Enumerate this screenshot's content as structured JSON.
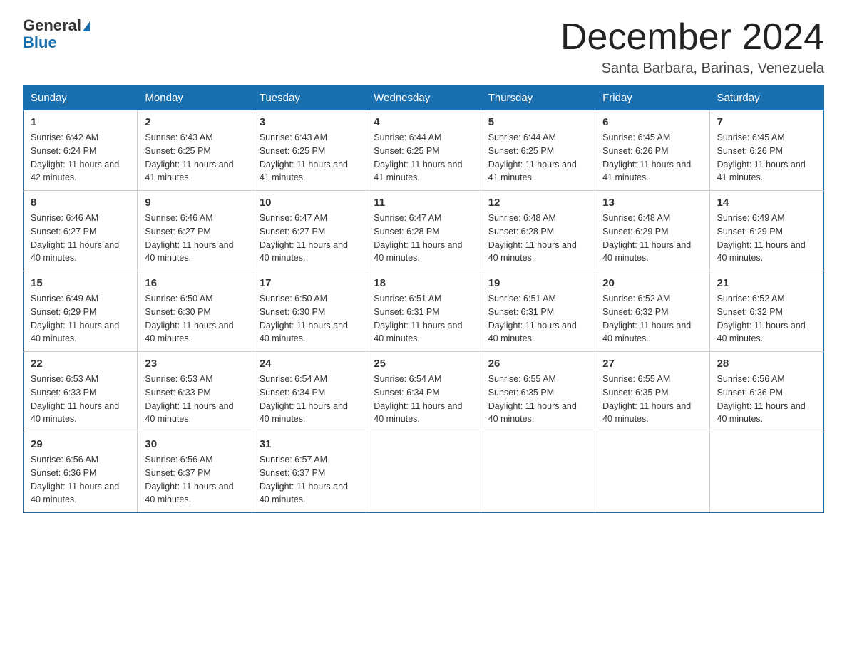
{
  "logo": {
    "text_general": "General",
    "text_blue": "Blue"
  },
  "header": {
    "month_title": "December 2024",
    "subtitle": "Santa Barbara, Barinas, Venezuela"
  },
  "columns": [
    "Sunday",
    "Monday",
    "Tuesday",
    "Wednesday",
    "Thursday",
    "Friday",
    "Saturday"
  ],
  "weeks": [
    [
      {
        "day": "1",
        "sunrise": "Sunrise: 6:42 AM",
        "sunset": "Sunset: 6:24 PM",
        "daylight": "Daylight: 11 hours and 42 minutes."
      },
      {
        "day": "2",
        "sunrise": "Sunrise: 6:43 AM",
        "sunset": "Sunset: 6:25 PM",
        "daylight": "Daylight: 11 hours and 41 minutes."
      },
      {
        "day": "3",
        "sunrise": "Sunrise: 6:43 AM",
        "sunset": "Sunset: 6:25 PM",
        "daylight": "Daylight: 11 hours and 41 minutes."
      },
      {
        "day": "4",
        "sunrise": "Sunrise: 6:44 AM",
        "sunset": "Sunset: 6:25 PM",
        "daylight": "Daylight: 11 hours and 41 minutes."
      },
      {
        "day": "5",
        "sunrise": "Sunrise: 6:44 AM",
        "sunset": "Sunset: 6:25 PM",
        "daylight": "Daylight: 11 hours and 41 minutes."
      },
      {
        "day": "6",
        "sunrise": "Sunrise: 6:45 AM",
        "sunset": "Sunset: 6:26 PM",
        "daylight": "Daylight: 11 hours and 41 minutes."
      },
      {
        "day": "7",
        "sunrise": "Sunrise: 6:45 AM",
        "sunset": "Sunset: 6:26 PM",
        "daylight": "Daylight: 11 hours and 41 minutes."
      }
    ],
    [
      {
        "day": "8",
        "sunrise": "Sunrise: 6:46 AM",
        "sunset": "Sunset: 6:27 PM",
        "daylight": "Daylight: 11 hours and 40 minutes."
      },
      {
        "day": "9",
        "sunrise": "Sunrise: 6:46 AM",
        "sunset": "Sunset: 6:27 PM",
        "daylight": "Daylight: 11 hours and 40 minutes."
      },
      {
        "day": "10",
        "sunrise": "Sunrise: 6:47 AM",
        "sunset": "Sunset: 6:27 PM",
        "daylight": "Daylight: 11 hours and 40 minutes."
      },
      {
        "day": "11",
        "sunrise": "Sunrise: 6:47 AM",
        "sunset": "Sunset: 6:28 PM",
        "daylight": "Daylight: 11 hours and 40 minutes."
      },
      {
        "day": "12",
        "sunrise": "Sunrise: 6:48 AM",
        "sunset": "Sunset: 6:28 PM",
        "daylight": "Daylight: 11 hours and 40 minutes."
      },
      {
        "day": "13",
        "sunrise": "Sunrise: 6:48 AM",
        "sunset": "Sunset: 6:29 PM",
        "daylight": "Daylight: 11 hours and 40 minutes."
      },
      {
        "day": "14",
        "sunrise": "Sunrise: 6:49 AM",
        "sunset": "Sunset: 6:29 PM",
        "daylight": "Daylight: 11 hours and 40 minutes."
      }
    ],
    [
      {
        "day": "15",
        "sunrise": "Sunrise: 6:49 AM",
        "sunset": "Sunset: 6:29 PM",
        "daylight": "Daylight: 11 hours and 40 minutes."
      },
      {
        "day": "16",
        "sunrise": "Sunrise: 6:50 AM",
        "sunset": "Sunset: 6:30 PM",
        "daylight": "Daylight: 11 hours and 40 minutes."
      },
      {
        "day": "17",
        "sunrise": "Sunrise: 6:50 AM",
        "sunset": "Sunset: 6:30 PM",
        "daylight": "Daylight: 11 hours and 40 minutes."
      },
      {
        "day": "18",
        "sunrise": "Sunrise: 6:51 AM",
        "sunset": "Sunset: 6:31 PM",
        "daylight": "Daylight: 11 hours and 40 minutes."
      },
      {
        "day": "19",
        "sunrise": "Sunrise: 6:51 AM",
        "sunset": "Sunset: 6:31 PM",
        "daylight": "Daylight: 11 hours and 40 minutes."
      },
      {
        "day": "20",
        "sunrise": "Sunrise: 6:52 AM",
        "sunset": "Sunset: 6:32 PM",
        "daylight": "Daylight: 11 hours and 40 minutes."
      },
      {
        "day": "21",
        "sunrise": "Sunrise: 6:52 AM",
        "sunset": "Sunset: 6:32 PM",
        "daylight": "Daylight: 11 hours and 40 minutes."
      }
    ],
    [
      {
        "day": "22",
        "sunrise": "Sunrise: 6:53 AM",
        "sunset": "Sunset: 6:33 PM",
        "daylight": "Daylight: 11 hours and 40 minutes."
      },
      {
        "day": "23",
        "sunrise": "Sunrise: 6:53 AM",
        "sunset": "Sunset: 6:33 PM",
        "daylight": "Daylight: 11 hours and 40 minutes."
      },
      {
        "day": "24",
        "sunrise": "Sunrise: 6:54 AM",
        "sunset": "Sunset: 6:34 PM",
        "daylight": "Daylight: 11 hours and 40 minutes."
      },
      {
        "day": "25",
        "sunrise": "Sunrise: 6:54 AM",
        "sunset": "Sunset: 6:34 PM",
        "daylight": "Daylight: 11 hours and 40 minutes."
      },
      {
        "day": "26",
        "sunrise": "Sunrise: 6:55 AM",
        "sunset": "Sunset: 6:35 PM",
        "daylight": "Daylight: 11 hours and 40 minutes."
      },
      {
        "day": "27",
        "sunrise": "Sunrise: 6:55 AM",
        "sunset": "Sunset: 6:35 PM",
        "daylight": "Daylight: 11 hours and 40 minutes."
      },
      {
        "day": "28",
        "sunrise": "Sunrise: 6:56 AM",
        "sunset": "Sunset: 6:36 PM",
        "daylight": "Daylight: 11 hours and 40 minutes."
      }
    ],
    [
      {
        "day": "29",
        "sunrise": "Sunrise: 6:56 AM",
        "sunset": "Sunset: 6:36 PM",
        "daylight": "Daylight: 11 hours and 40 minutes."
      },
      {
        "day": "30",
        "sunrise": "Sunrise: 6:56 AM",
        "sunset": "Sunset: 6:37 PM",
        "daylight": "Daylight: 11 hours and 40 minutes."
      },
      {
        "day": "31",
        "sunrise": "Sunrise: 6:57 AM",
        "sunset": "Sunset: 6:37 PM",
        "daylight": "Daylight: 11 hours and 40 minutes."
      },
      null,
      null,
      null,
      null
    ]
  ]
}
